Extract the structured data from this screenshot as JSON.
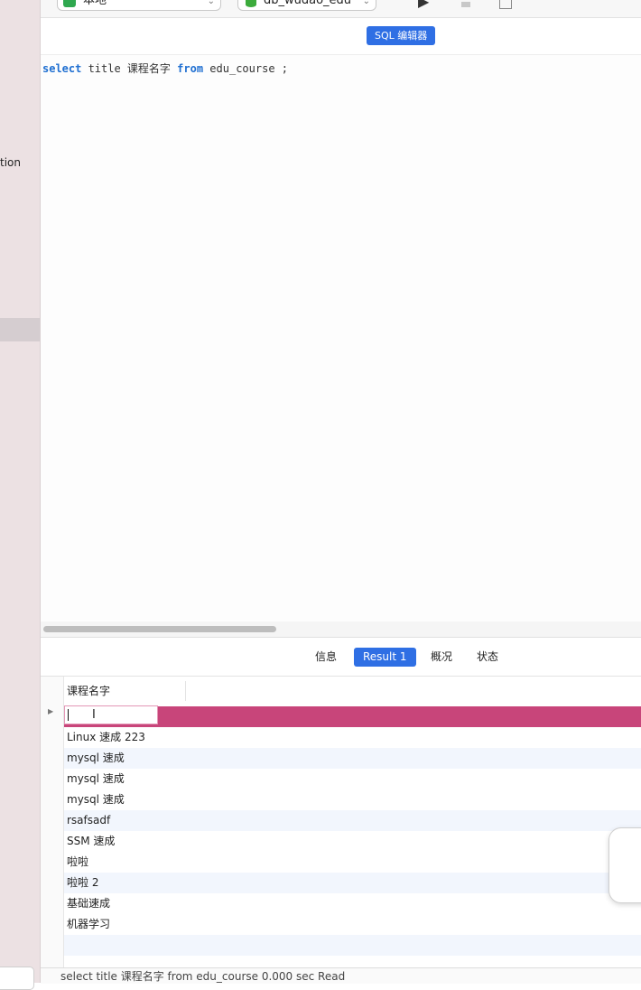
{
  "sidebar": {
    "partial_text": "tion"
  },
  "toolbar": {
    "connection": "本地",
    "database": "db_wudao_edu",
    "icons": [
      "connection-icon",
      "database-icon",
      "run-icon",
      "stop-icon",
      "explain-icon"
    ]
  },
  "editor": {
    "badge": "SQL 编辑器",
    "code": {
      "kw_select": "select",
      "part1": " title 课程名字 ",
      "kw_from": "from",
      "part2": " edu_course ;"
    }
  },
  "tabs": {
    "info": "信息",
    "result": "Result 1",
    "overview": "概况",
    "status": "状态"
  },
  "grid": {
    "column": "课程名字",
    "rows": [
      "",
      "Linux 速成 223",
      "mysql 速成",
      "mysql 速成",
      "mysql 速成",
      "rsafsadf",
      "SSM 速成",
      "啦啦",
      "啦啦 2",
      "基础速成",
      "机器学习",
      ""
    ]
  },
  "statusbar": {
    "text": "select title 课程名字 from edu_course  0.000 sec  Read"
  },
  "colors": {
    "accent": "#2f6fe4",
    "selected_row": "#c8457a",
    "keyword": "#1f6fd1"
  }
}
